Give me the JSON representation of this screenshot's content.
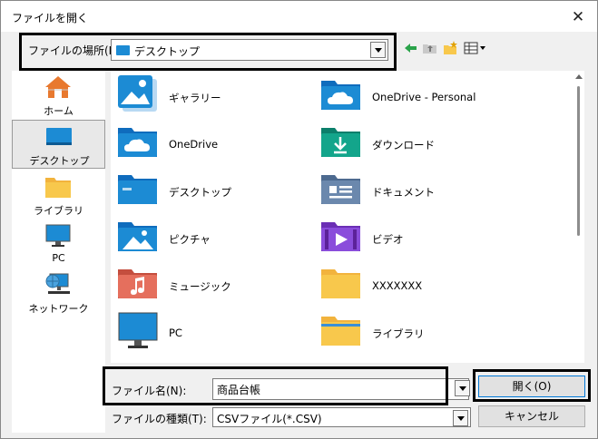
{
  "window": {
    "title": "ファイルを開く"
  },
  "location": {
    "label": "ファイルの場所(I):",
    "value": "デスクトップ"
  },
  "toolbar": {
    "icons": [
      "back-arrow-icon",
      "up-folder-icon",
      "new-folder-icon",
      "view-menu-icon"
    ]
  },
  "sidebar": {
    "items": [
      {
        "label": "ホーム",
        "icon": "home-icon"
      },
      {
        "label": "デスクトップ",
        "icon": "desktop-icon",
        "selected": true
      },
      {
        "label": "ライブラリ",
        "icon": "library-folder-icon"
      },
      {
        "label": "PC",
        "icon": "monitor-icon"
      },
      {
        "label": "ネットワーク",
        "icon": "network-icon"
      }
    ]
  },
  "files": [
    {
      "label": "ギャラリー",
      "icon": "gallery-icon"
    },
    {
      "label": "OneDrive - Personal",
      "icon": "onedrive-folder-icon"
    },
    {
      "label": "OneDrive",
      "icon": "onedrive-folder-icon"
    },
    {
      "label": "ダウンロード",
      "icon": "downloads-folder-icon"
    },
    {
      "label": "デスクトップ",
      "icon": "desktop-folder-icon"
    },
    {
      "label": "ドキュメント",
      "icon": "documents-folder-icon"
    },
    {
      "label": "ピクチャ",
      "icon": "pictures-folder-icon"
    },
    {
      "label": "ビデオ",
      "icon": "videos-folder-icon"
    },
    {
      "label": "ミュージック",
      "icon": "music-folder-icon"
    },
    {
      "label": "XXXXXXX",
      "icon": "folder-icon"
    },
    {
      "label": "PC",
      "icon": "monitor-icon"
    },
    {
      "label": "ライブラリ",
      "icon": "library-folder-icon"
    }
  ],
  "filename": {
    "label": "ファイル名(N):",
    "value": "商品台帳"
  },
  "filetype": {
    "label": "ファイルの種類(T):",
    "value": "CSVファイル(*.CSV)"
  },
  "buttons": {
    "open": "開く(O)",
    "cancel": "キャンセル"
  },
  "colors": {
    "folder_yellow": "#f8c84c",
    "folder_blue": "#1c8bd4",
    "accent": "#0078d7"
  }
}
